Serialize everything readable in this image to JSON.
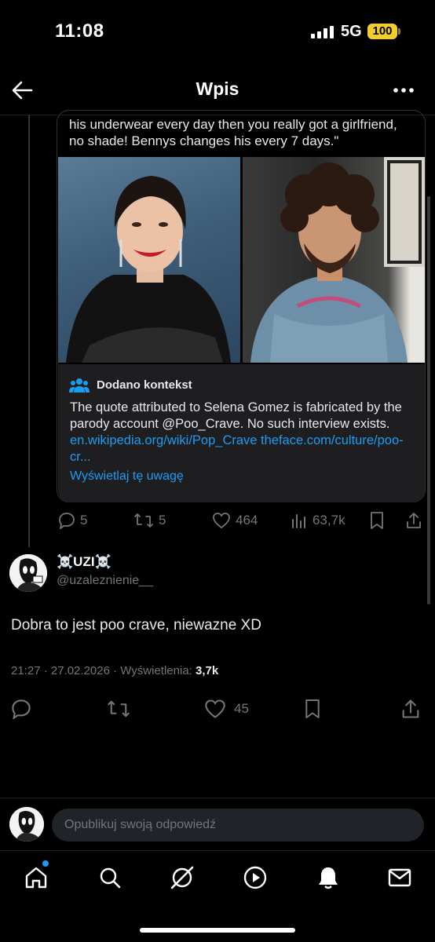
{
  "status_bar": {
    "time": "11:08",
    "network": "5G",
    "battery": "100"
  },
  "header": {
    "title": "Wpis"
  },
  "quoted_post": {
    "text_tail": "his underwear every day then you really got a girlfriend, no shade! Bennys changes his every 7 days.\"",
    "images": [
      "selena-gomez-photo",
      "benny-blanco-photo"
    ],
    "context_note": {
      "title": "Dodano kontekst",
      "body": "The quote attributed to Selena Gomez is fabricated by the parody account @Poo_Crave. No such interview exists.",
      "links": "en.wikipedia.org/wiki/Pop_Crave theface.com/culture/poo-cr...",
      "view_label": "Wyświetlaj tę uwagę"
    },
    "actions": {
      "replies": "5",
      "reposts": "5",
      "likes": "464",
      "views": "63,7k"
    }
  },
  "reply": {
    "name": "☠️UZI☠️",
    "handle": "@uzaleznienie__",
    "text": "Dobra to jest poo crave, niewazne XD",
    "time": "21:27 · 27.02.2026 · Wyświetlenia: ",
    "views": "3,7k",
    "actions": {
      "likes": "45"
    }
  },
  "compose": {
    "placeholder": "Opublikuj swoją odpowiedź"
  },
  "colors": {
    "accent": "#1d9bf0",
    "muted": "#71767b",
    "battery": "#f2cd2e"
  },
  "nav": [
    "home-icon",
    "search-icon",
    "grok-icon",
    "video-icon",
    "notifications-icon",
    "messages-icon"
  ]
}
